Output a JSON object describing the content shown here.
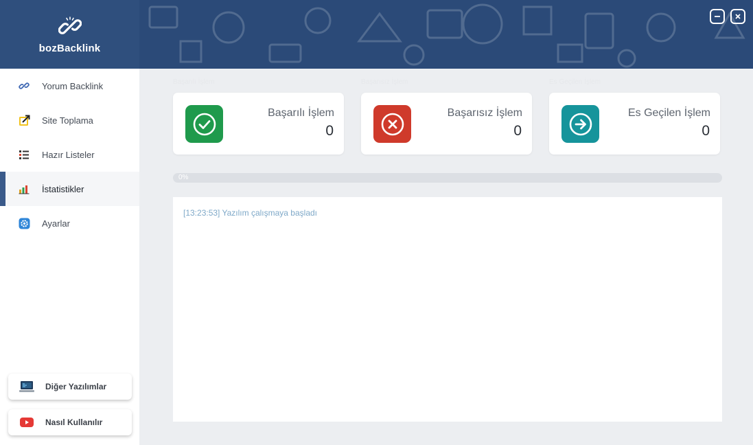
{
  "app": {
    "name": "bozBacklink"
  },
  "sidebar": {
    "items": [
      {
        "label": "Yorum Backlink",
        "icon": "link-icon",
        "active": false
      },
      {
        "label": "Site Toplama",
        "icon": "external-link-icon",
        "active": false
      },
      {
        "label": "Hazır Listeler",
        "icon": "list-icon",
        "active": false
      },
      {
        "label": "İstatistikler",
        "icon": "bar-chart-icon",
        "active": true
      },
      {
        "label": "Ayarlar",
        "icon": "gear-icon",
        "active": false
      }
    ],
    "buttons": {
      "other": {
        "label": "Diğer Yazılımlar",
        "icon": "laptop-icon"
      },
      "how": {
        "label": "Nasıl Kullanılır",
        "icon": "youtube-icon"
      }
    }
  },
  "stats": {
    "success": {
      "caption": "Başarılı İşlem",
      "title": "Başarılı İşlem",
      "count": "0",
      "color": "#1f9a4c"
    },
    "failed": {
      "caption": "Başarısız İşlem",
      "title": "Başarısız İşlem",
      "count": "0",
      "color": "#cf3a2b"
    },
    "skipped": {
      "caption": "Es Geçilen İşlem",
      "title": "Es Geçilen İşlem",
      "count": "0",
      "color": "#16949b"
    }
  },
  "progress": {
    "value": 0,
    "label": "0%"
  },
  "log": {
    "lines": [
      "[13:23:53] Yazılım çalışmaya başladı"
    ]
  },
  "colors": {
    "header": "#2b4a78",
    "brand": "#2f4f7d",
    "accent": "#3a5a8a"
  }
}
